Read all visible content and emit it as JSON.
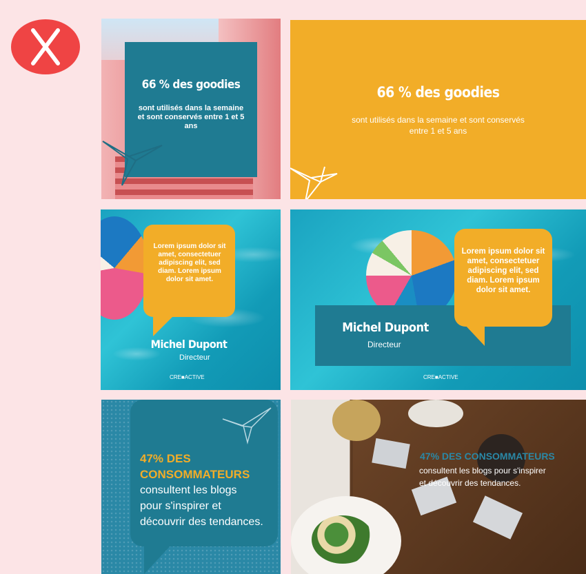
{
  "error_icon": {
    "color": "#ef4444"
  },
  "tile_stat_photo": {
    "title": "66 % des goodies",
    "body": "sont utilisés dans la semaine et sont conservés entre 1 et 5 ans"
  },
  "tile_stat_yellow": {
    "title": "66 % des goodies",
    "body": "sont utilisés dans la semaine et sont conservés entre 1 et 5 ans"
  },
  "tile_quote_square": {
    "bubble_text": "Lorem ipsum dolor sit amet, consectetuer adipiscing elit, sed diam. Lorem ipsum dolor sit amet.",
    "name": "Michel Dupont",
    "role": "Directeur",
    "brand": "CRE■ACTIVE"
  },
  "tile_quote_wide": {
    "bubble_text": "Lorem ipsum dolor sit amet, consectetuer adipiscing elit, sed diam. Lorem ipsum dolor sit amet.",
    "name": "Michel Dupont",
    "role": "Directeur",
    "brand": "CRE■ACTIVE"
  },
  "tile_consumers_square": {
    "heading_line1": "47% DES",
    "heading_line2": "CONSOMMATEURS",
    "body_line1": "consultent les blogs",
    "body_line2": "pour s'inspirer et",
    "body_line3": "découvrir des tendances."
  },
  "tile_consumers_photo": {
    "heading": "47% DES CONSOMMATEURS",
    "body_line1": "consultent les blogs pour s'inspirer",
    "body_line2": "et découvrir des tendances."
  },
  "colors": {
    "background": "#fce4e6",
    "teal": "#1f7b92",
    "yellow": "#f2ad28"
  }
}
